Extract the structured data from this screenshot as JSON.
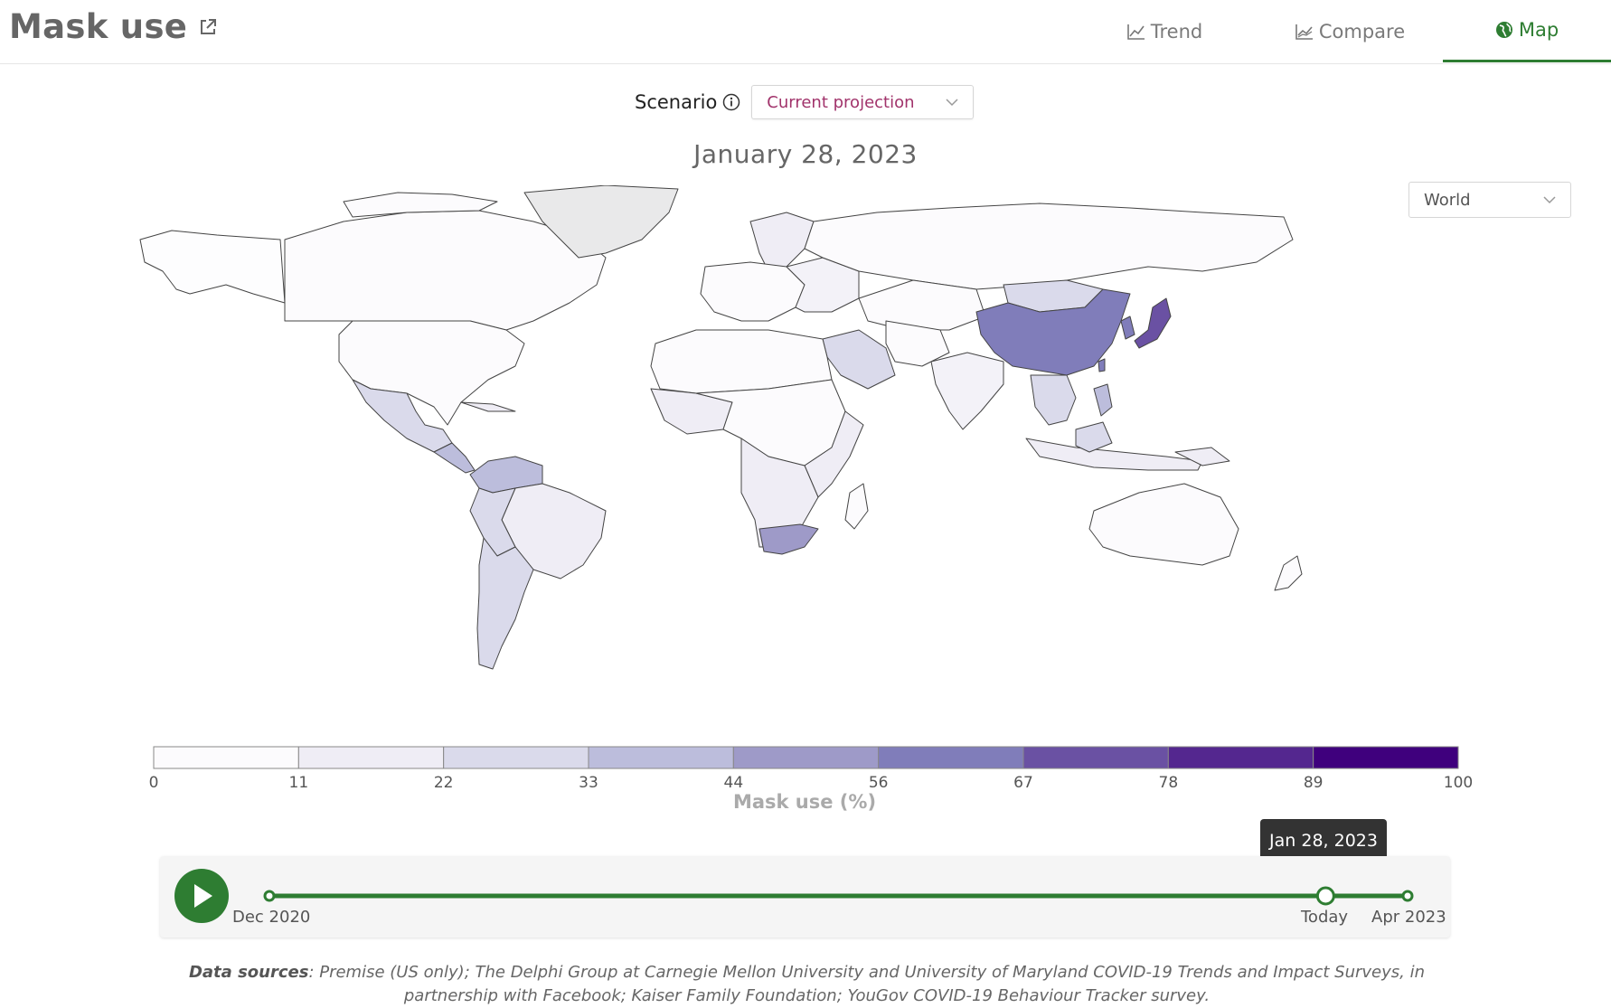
{
  "header": {
    "title": "Mask use",
    "tabs": [
      {
        "label": "Trend",
        "icon": "line-chart-icon"
      },
      {
        "label": "Compare",
        "icon": "compare-chart-icon"
      },
      {
        "label": "Map",
        "icon": "globe-icon",
        "active": true
      }
    ]
  },
  "scenario": {
    "label": "Scenario",
    "selected": "Current projection"
  },
  "map": {
    "date_title": "January 28, 2023",
    "region_selected": "World"
  },
  "legend": {
    "title": "Mask use (%)",
    "ticks": [
      "0",
      "11",
      "22",
      "33",
      "44",
      "56",
      "67",
      "78",
      "89",
      "100"
    ],
    "colors": [
      "#fcfbfd",
      "#efedf5",
      "#dadaeb",
      "#bcbddc",
      "#9e9ac8",
      "#807dba",
      "#6a51a3",
      "#54278f",
      "#3f007d"
    ]
  },
  "timeline": {
    "start_label": "Dec 2020",
    "today_label": "Today",
    "end_label": "Apr 2023",
    "tooltip": "Jan 28, 2023",
    "position": 0.928,
    "accent": "#2e7d32"
  },
  "sources": {
    "label": "Data sources",
    "text": ": Premise (US only); The Delphi Group at Carnegie Mellon University and University of Maryland COVID-19 Trends and Impact Surveys, in partnership with Facebook; Kaiser Family Foundation; YouGov COVID-19 Behaviour Tracker survey."
  }
}
